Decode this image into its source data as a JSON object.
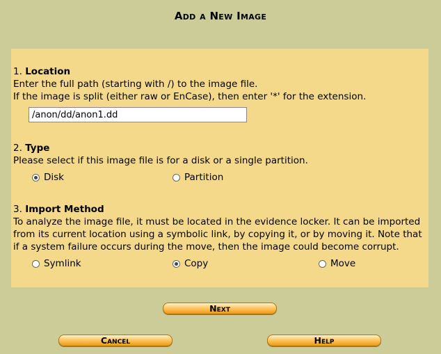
{
  "title": "Add a New Image",
  "location": {
    "number": "1.",
    "heading": "Location",
    "line1": "Enter the full path (starting with /) to the image file.",
    "line2": "If the image is split (either raw or EnCase), then enter '*' for the extension.",
    "path_value": "/anon/dd/anon1.dd"
  },
  "type": {
    "number": "2.",
    "heading": "Type",
    "description": "Please select if this image file is for a disk or a single partition.",
    "options": [
      {
        "label": "Disk",
        "checked": true
      },
      {
        "label": "Partition",
        "checked": false
      }
    ]
  },
  "import": {
    "number": "3.",
    "heading": "Import Method",
    "description": "To analyze the image file, it must be located in the evidence locker. It can be imported from its current location using a symbolic link, by copying it, or by moving it. Note that if a system failure occurs during the move, then the image could become corrupt.",
    "options": [
      {
        "label": "Symlink",
        "checked": false
      },
      {
        "label": "Copy",
        "checked": true
      },
      {
        "label": "Move",
        "checked": false
      }
    ]
  },
  "buttons": {
    "next": "Next",
    "cancel": "Cancel",
    "help": "Help"
  }
}
